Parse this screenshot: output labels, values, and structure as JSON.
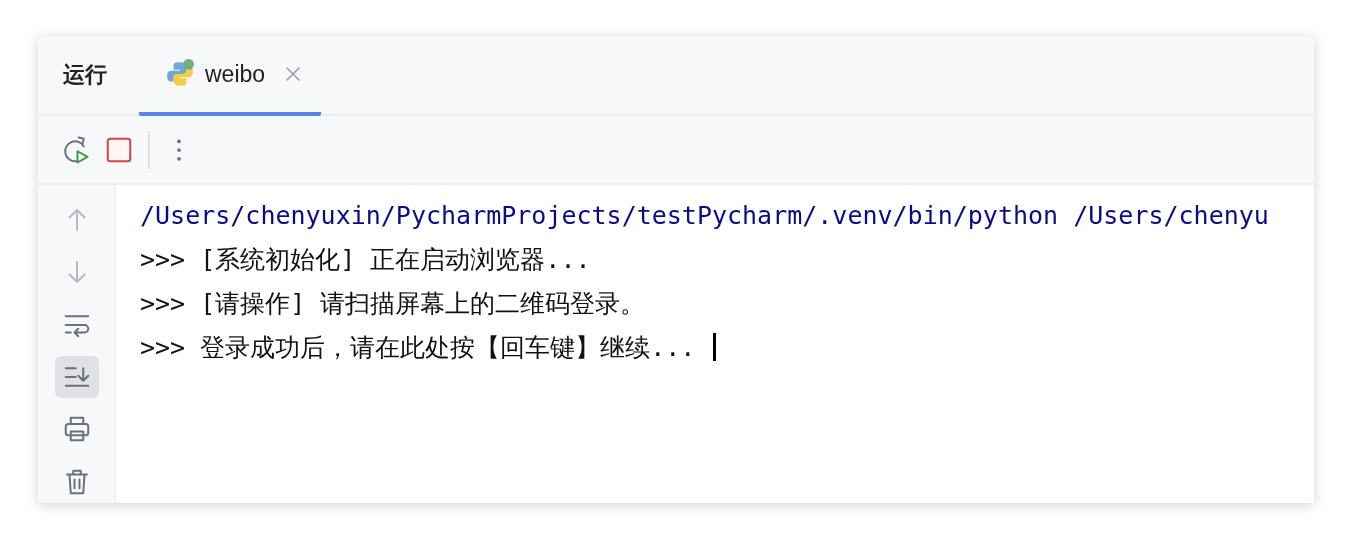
{
  "panel": {
    "title": "运行"
  },
  "tabs": [
    {
      "label": "weibo",
      "selected": true
    }
  ],
  "toolbar": [
    {
      "kind": "rerun"
    },
    {
      "kind": "stop"
    },
    {
      "kind": "separator"
    },
    {
      "kind": "more"
    }
  ],
  "sidebar": [
    {
      "kind": "up",
      "disabled": true,
      "selected": false
    },
    {
      "kind": "down",
      "disabled": true,
      "selected": false
    },
    {
      "kind": "wrap",
      "disabled": false,
      "selected": false
    },
    {
      "kind": "scroll-end",
      "disabled": false,
      "selected": true
    },
    {
      "kind": "print",
      "disabled": false,
      "selected": false
    },
    {
      "kind": "delete",
      "disabled": false,
      "selected": false
    }
  ],
  "console": {
    "lines": [
      {
        "kind": "command",
        "text": "/Users/chenyuxin/PycharmProjects/testPycharm/.venv/bin/python /Users/chenyu"
      },
      {
        "kind": "output",
        "text": ">>> [系统初始化] 正在启动浏览器..."
      },
      {
        "kind": "output",
        "text": ">>> [请操作] 请扫描屏幕上的二维码登录。"
      },
      {
        "kind": "output",
        "text": ">>> 登录成功后，请在此处按【回车键】继续..."
      }
    ]
  }
}
